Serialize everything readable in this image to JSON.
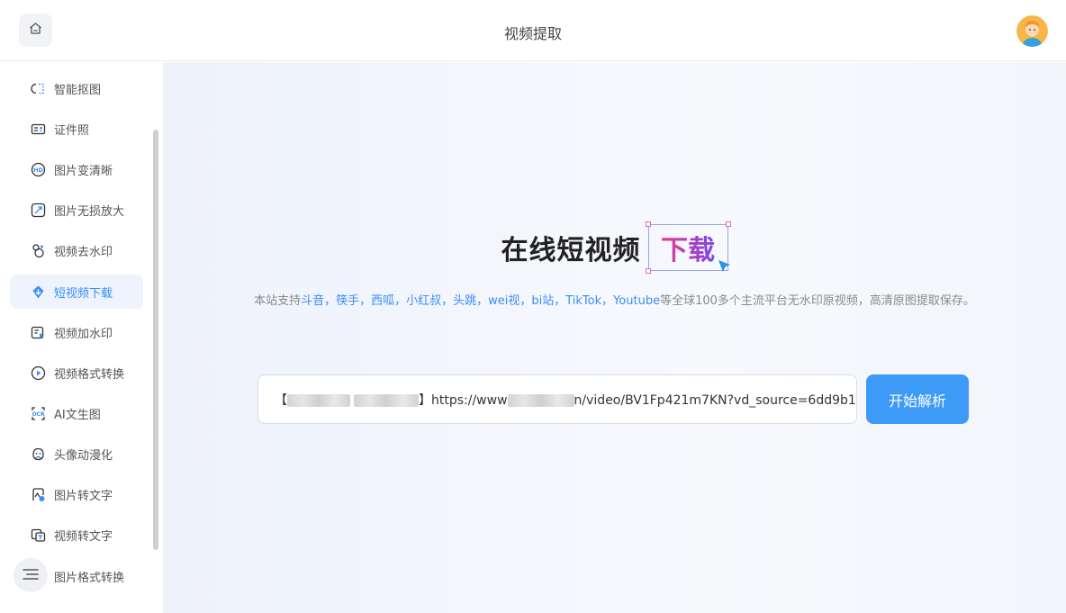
{
  "header": {
    "title": "视频提取",
    "home_icon": "home-icon",
    "avatar_icon": "user-avatar"
  },
  "sidebar": {
    "items": [
      {
        "label": "智能抠图",
        "icon": "cutout-icon",
        "active": false
      },
      {
        "label": "证件照",
        "icon": "id-card-icon",
        "active": false
      },
      {
        "label": "图片变清晰",
        "icon": "hd-icon",
        "active": false
      },
      {
        "label": "图片无损放大",
        "icon": "enlarge-icon",
        "active": false
      },
      {
        "label": "视频去水印",
        "icon": "watermark-remove-icon",
        "active": false
      },
      {
        "label": "短视频下载",
        "icon": "download-icon",
        "active": true
      },
      {
        "label": "视频加水印",
        "icon": "watermark-add-icon",
        "active": false
      },
      {
        "label": "视频格式转换",
        "icon": "video-convert-icon",
        "active": false
      },
      {
        "label": "AI文生图",
        "icon": "ai-image-icon",
        "active": false
      },
      {
        "label": "头像动漫化",
        "icon": "anime-avatar-icon",
        "active": false
      },
      {
        "label": "图片转文字",
        "icon": "image-to-text-icon",
        "active": false
      },
      {
        "label": "视频转文字",
        "icon": "video-to-text-icon",
        "active": false
      },
      {
        "label": "图片格式转换",
        "icon": "image-convert-icon",
        "active": false
      }
    ],
    "collapse_icon": "menu-icon"
  },
  "main": {
    "hero_title": "在线短视频",
    "hero_accent": "下载",
    "subtitle_prefix": "本站支持",
    "subtitle_platforms": "斗音，筷手，西呱，小红叔，头跳，wei视，bi站，TikTok，Youtube",
    "subtitle_suffix": "等全球100多个主流平台无水印原视频，高清原图提取保存。",
    "url_open": "【",
    "url_close": "】https://www",
    "url_rest": "n/video/BV1Fp421m7KN?vd_source=6dd9b1",
    "parse_button": "开始解析"
  },
  "colors": {
    "accent": "#3d9bf7",
    "active_bg": "#eef3fd",
    "gradient_start": "#ea3c8f",
    "gradient_end": "#7a46e8"
  }
}
